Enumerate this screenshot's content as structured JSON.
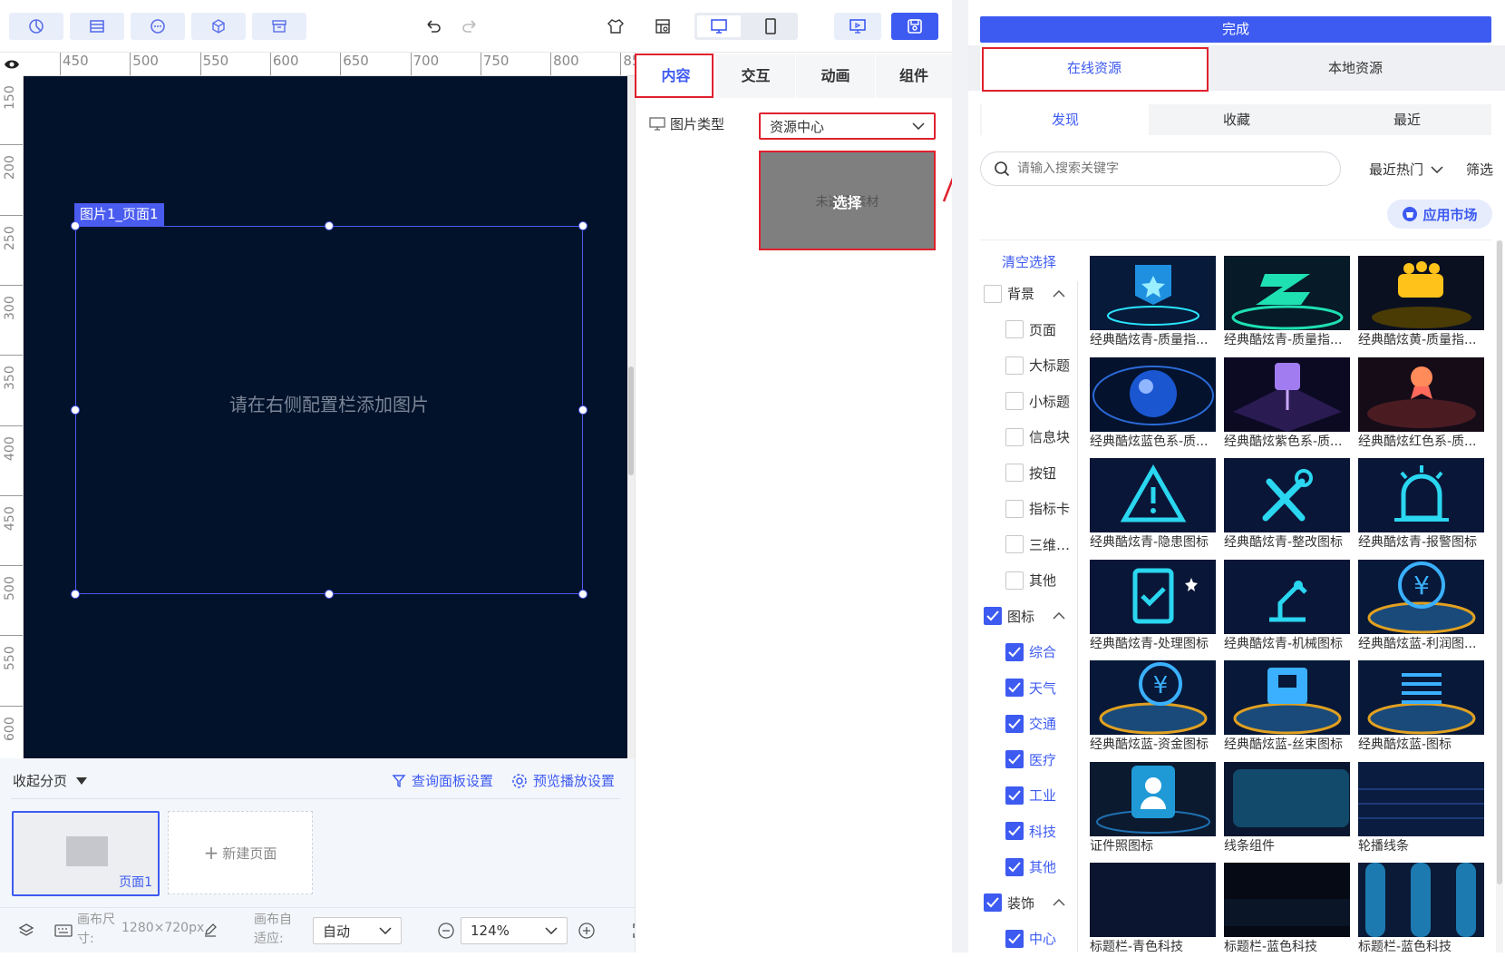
{
  "canvas": {
    "selection_tag": "图片1_页面1",
    "placeholder": "请在右侧配置栏添加图片",
    "ruler_top": [
      "450",
      "500",
      "550",
      "600",
      "650",
      "700",
      "750",
      "800",
      "85"
    ],
    "ruler_left": [
      "150",
      "200",
      "250",
      "300",
      "350",
      "400",
      "450",
      "500",
      "550",
      "600"
    ],
    "bg_color": "#02122b"
  },
  "pages": {
    "collapse_label": "收起分页",
    "query_panel_label": "查询面板设置",
    "preview_label": "预览播放设置",
    "page1_label": "页面1",
    "new_page_label": "新建页面"
  },
  "bottombar": {
    "canvas_size_label": "画布尺寸:",
    "canvas_size_value": "1280×720px",
    "adapt_label": "画布自适应:",
    "adapt_value": "自动",
    "zoom_value": "124%"
  },
  "config": {
    "tabs": [
      "内容",
      "交互",
      "动画",
      "组件"
    ],
    "image_type_label": "图片类型",
    "image_type_value": "资源中心",
    "material_hint": "未选择素材",
    "select_label": "选择"
  },
  "resource": {
    "done_label": "完成",
    "tabs": [
      "在线资源",
      "本地资源"
    ],
    "subtabs": [
      "发现",
      "收藏",
      "最近"
    ],
    "search_placeholder": "请输入搜索关键字",
    "sort_label": "最近热门",
    "filter_label": "筛选",
    "market_label": "应用市场",
    "clear_label": "清空选择",
    "categories": [
      {
        "label": "背景",
        "checked": false,
        "sub": [
          "页面",
          "大标题",
          "小标题",
          "信息块",
          "按钮",
          "指标卡",
          "三维…",
          "其他"
        ],
        "sub_checked": false
      },
      {
        "label": "图标",
        "checked": true,
        "sub": [
          "综合",
          "天气",
          "交通",
          "医疗",
          "工业",
          "科技",
          "其他"
        ],
        "sub_checked": true
      },
      {
        "label": "装饰",
        "checked": true,
        "sub": [
          "中心"
        ],
        "sub_checked": true
      }
    ],
    "items": [
      "经典酷炫青-质量指...",
      "经典酷炫青-质量指...",
      "经典酷炫黄-质量指...",
      "经典酷炫蓝色系-质...",
      "经典酷炫紫色系-质...",
      "经典酷炫红色系-质...",
      "经典酷炫青-隐患图标",
      "经典酷炫青-整改图标",
      "经典酷炫青-报警图标",
      "经典酷炫青-处理图标",
      "经典酷炫青-机械图标",
      "经典酷炫蓝-利润图...",
      "经典酷炫蓝-资金图标",
      "经典酷炫蓝-丝束图标",
      "经典酷炫蓝-图标",
      "证件照图标",
      "线条组件",
      "轮播线条",
      "标题栏-青色科技",
      "标题栏-蓝色科技",
      "标题栏-蓝色科技"
    ],
    "accent": "#3d5af1"
  }
}
